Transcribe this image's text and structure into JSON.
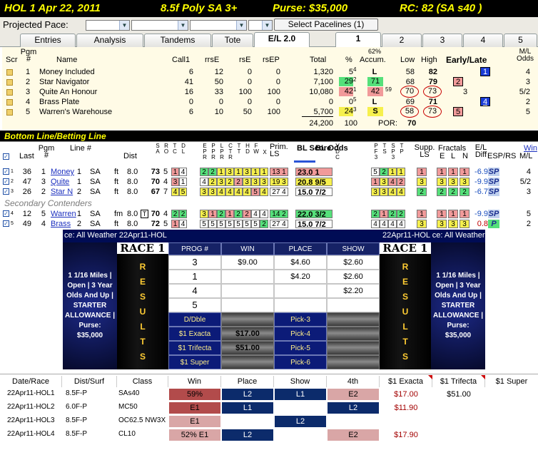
{
  "header": {
    "race": "HOL  1  Apr 22, 2011",
    "conditions": "8.5f Poly SA 3+",
    "purse": "Purse: $35,000",
    "rc": "RC: 82  (SA s40 )"
  },
  "pace": {
    "label": "Projected Pace:",
    "select_button": "Select Pacelines  (1)"
  },
  "tabs": [
    {
      "label": "Entries"
    },
    {
      "label": "Analysis"
    },
    {
      "label": "Tandems"
    },
    {
      "label": "Tote"
    },
    {
      "label": "E/L 2.0"
    },
    {
      "label": "1"
    },
    {
      "label": "2"
    },
    {
      "label": "3"
    },
    {
      "label": "4"
    },
    {
      "label": "5"
    }
  ],
  "main": {
    "headers": {
      "scr": "Scr",
      "pgm": "Pgm #",
      "name": "Name",
      "call1": "Call1",
      "rrse": "rrsE",
      "rse": "rsE",
      "rsep": "rsEP",
      "total": "Total",
      "pct": "%",
      "accum": "Accum.",
      "accum_top": "62%",
      "low": "Low",
      "high": "High",
      "early_late": "Early/Late",
      "ml": "M/L Odds"
    },
    "rows": [
      {
        "pgm": "1",
        "name": "Money Included",
        "call1": "6",
        "rrse": "12",
        "rse": "0",
        "rsep": "0",
        "total": "1,320",
        "pct": "5",
        "pct_sup": "4",
        "accum": "L",
        "low": "58",
        "high": "82",
        "el": "1",
        "ml": "4"
      },
      {
        "pgm": "2",
        "name": "Star Navigator",
        "call1": "41",
        "rrse": "50",
        "rse": "0",
        "rsep": "0",
        "total": "7,100",
        "pct": "29",
        "pct_sup": "2",
        "accum": "71",
        "low": "68",
        "high": "79",
        "el": "2",
        "ml": "3"
      },
      {
        "pgm": "3",
        "name": "Quite An Honour",
        "call1": "16",
        "rrse": "33",
        "rse": "100",
        "rsep": "100",
        "total": "10,080",
        "pct": "42",
        "pct_sup": "1",
        "accum": "42",
        "accum_sup": "59",
        "low": "70",
        "high": "73",
        "el": "3",
        "ml": "5/2"
      },
      {
        "pgm": "4",
        "name": "Brass Plate",
        "call1": "0",
        "rrse": "0",
        "rse": "0",
        "rsep": "0",
        "total": "0",
        "pct": "0",
        "pct_sup": "5",
        "accum": "L",
        "low": "69",
        "high": "71",
        "el": "4",
        "ml": "2"
      },
      {
        "pgm": "5",
        "name": "Warren's Warehouse",
        "call1": "6",
        "rrse": "10",
        "rse": "50",
        "rsep": "100",
        "total": "5,700",
        "pct": "24",
        "pct_sup": "3",
        "accum": "S",
        "low": "58",
        "high": "73",
        "el": "5",
        "ml": "5"
      }
    ],
    "footer_total": "24,200",
    "footer_pct": "100",
    "por_label": "POR:",
    "por_value": "70"
  },
  "bottom_line": {
    "title": "Bottom Line/Betting Line",
    "headers": {
      "last": "Last",
      "pgm": "Pgm #",
      "line": "Line #",
      "dist": "Dist",
      "prim": "Prim. LS",
      "bl_score": "BL Score",
      "bl_odds": "BL Odds",
      "supp": "Supp. LS",
      "fractals": "Fractals",
      "fr_e": "E",
      "fr_l": "L",
      "fr_n": "N",
      "el_diff": "E/L Diff",
      "esp": "ESP/RS",
      "win": "Win",
      "ml": "M/L"
    },
    "vert_headers": [
      "S A",
      "R O",
      "T C",
      "D L",
      "E P R",
      "P P R",
      "L P R",
      "C T R",
      "T T",
      "H D",
      "F W",
      "X",
      "V D C",
      "P F 3",
      "T S",
      "S P 3",
      "T P"
    ],
    "rows": [
      {
        "rank": "1",
        "last": "36",
        "pgm": "1",
        "name": "Money",
        "line": "1",
        "surf": "SA",
        "type": "ft",
        "dist": "8.0",
        "a": "73",
        "b": "5",
        "score": "23.0",
        "odds": "1",
        "el_diff": "-6.9",
        "esp": "SP",
        "ml": "4"
      },
      {
        "rank": "2",
        "last": "47",
        "pgm": "3",
        "name": "Quite",
        "line": "1",
        "surf": "SA",
        "type": "ft",
        "dist": "8.0",
        "a": "70",
        "b": "4",
        "score": "20.8",
        "odds": "9/5",
        "el_diff": "-9.9",
        "esp": "SP",
        "ml": "5/2"
      },
      {
        "rank": "3",
        "last": "26",
        "pgm": "2",
        "name": "Star N",
        "line": "2",
        "surf": "SA",
        "type": "ft",
        "dist": "8.0",
        "a": "67",
        "b": "7",
        "score": "15.0",
        "odds": "7/2",
        "el_diff": "-6.7",
        "esp": "SP",
        "ml": "3"
      },
      {
        "rank": "4",
        "last": "12",
        "pgm": "5",
        "name": "Warren",
        "line": "1",
        "surf": "SA",
        "type": "fm",
        "dist": "8.0",
        "a": "70",
        "b": "4",
        "score": "22.0",
        "odds": "3/2",
        "el_diff": "-9.9",
        "esp": "SP",
        "ml": "5"
      },
      {
        "rank": "5",
        "last": "49",
        "pgm": "4",
        "name": "Brass",
        "line": "2",
        "surf": "SA",
        "type": "ft",
        "dist": "8.0",
        "a": "72",
        "b": "5",
        "score": "15.0",
        "odds": "7/2",
        "el_diff": "0.8",
        "esp": "P",
        "ml": "2"
      }
    ],
    "secondary_label": "Secondary Contenders",
    "row_prims": [
      "13 1",
      "19 3",
      "27 4",
      "14 2",
      "27 4"
    ]
  },
  "results": {
    "marquee_left": "ce: All Weather   22Apr11-HOL",
    "marquee_right": "22Apr11-HOL   ce: All Weather",
    "race_title": "RACE 1",
    "results_letters": [
      "R",
      "E",
      "S",
      "U",
      "L",
      "T",
      "S"
    ],
    "side_text": [
      "1 1/16 Miles |",
      "Open | 3 Year",
      "Olds And Up |",
      "STARTER",
      "ALLOWANCE |",
      "Purse:",
      "$35,000"
    ],
    "col_prog": "PROG #",
    "col_win": "WIN",
    "col_place": "PLACE",
    "col_show": "SHOW",
    "rows": [
      {
        "prog": "3",
        "win": "$9.00",
        "place": "$4.60",
        "show": "$2.60"
      },
      {
        "prog": "1",
        "win": "",
        "place": "$4.20",
        "show": "$2.60"
      },
      {
        "prog": "4",
        "win": "",
        "place": "",
        "show": "$2.20"
      },
      {
        "prog": "5",
        "win": "",
        "place": "",
        "show": ""
      }
    ],
    "exotics": [
      {
        "label": "D/Dble",
        "value": "",
        "pick": "Pick-3"
      },
      {
        "label": "$1 Exacta",
        "value": "$17.00",
        "pick": "Pick-4"
      },
      {
        "label": "$1 Trifecta",
        "value": "$51.00",
        "pick": "Pick-5"
      },
      {
        "label": "$1 Super",
        "value": "",
        "pick": "Pick-6"
      }
    ]
  },
  "history": {
    "headers": [
      "Date/Race",
      "Dist/Surf",
      "Class",
      "Win",
      "Place",
      "Show",
      "4th",
      "$1 Exacta",
      "$1 Trifecta",
      "$1 Super"
    ],
    "rows": [
      {
        "date": "22Apr11-HOL1",
        "dist": "8.5F-P",
        "class": "SAs40",
        "win": "59%",
        "place": "L2",
        "show": "L1",
        "fourth": "E2",
        "exacta": "$17.00",
        "trifecta": "$51.00",
        "super": ""
      },
      {
        "date": "22Apr11-HOL2",
        "dist": "6.0F-P",
        "class": "MC50",
        "win": "E1",
        "place": "L1",
        "show": "",
        "fourth": "L2",
        "exacta": "$11.90",
        "trifecta": "",
        "super": ""
      },
      {
        "date": "22Apr11-HOL3",
        "dist": "8.5F-P",
        "class": "OC62.5 NW3X",
        "win": "E1",
        "place": "",
        "show": "L2",
        "fourth": "",
        "exacta": "",
        "trifecta": "",
        "super": ""
      },
      {
        "date": "22Apr11-HOL4",
        "dist": "8.5F-P",
        "class": "CL10",
        "win": "52% E1",
        "place": "L2",
        "show": "",
        "fourth": "E2",
        "exacta": "$17.90",
        "trifecta": "",
        "super": ""
      }
    ]
  }
}
